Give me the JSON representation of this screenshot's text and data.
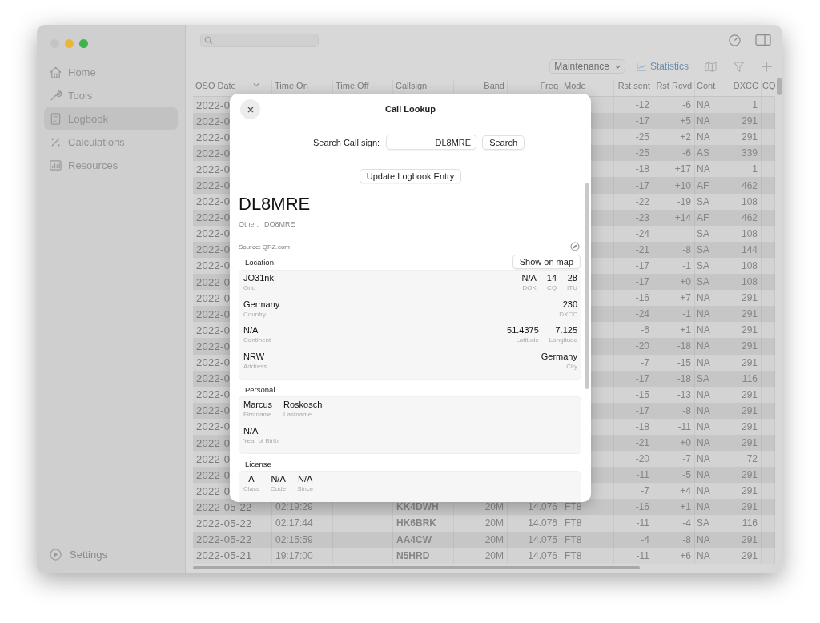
{
  "sidebar": {
    "items": [
      {
        "label": "Home",
        "selected": false
      },
      {
        "label": "Tools",
        "selected": false
      },
      {
        "label": "Logbook",
        "selected": true
      },
      {
        "label": "Calculations",
        "selected": false
      },
      {
        "label": "Resources",
        "selected": false
      }
    ],
    "settings": "Settings"
  },
  "toolbar": {
    "dropdown": "Maintenance",
    "statistics": "Statistics"
  },
  "table": {
    "columns": [
      "QSO Date",
      "Time On",
      "Time Off",
      "Callsign",
      "Band",
      "Freq",
      "Mode",
      "Rst sent",
      "Rst Rcvd",
      "Cont",
      "DXCC",
      "CQ"
    ],
    "rows": [
      {
        "date": "2022-0",
        "rst_sent": "-12",
        "rst_rcvd": "-6",
        "cont": "NA",
        "dxcc": "1"
      },
      {
        "date": "2022-0",
        "rst_sent": "-17",
        "rst_rcvd": "+5",
        "cont": "NA",
        "dxcc": "291"
      },
      {
        "date": "2022-0",
        "rst_sent": "-25",
        "rst_rcvd": "+2",
        "cont": "NA",
        "dxcc": "291"
      },
      {
        "date": "2022-0",
        "rst_sent": "-25",
        "rst_rcvd": "-6",
        "cont": "AS",
        "dxcc": "339"
      },
      {
        "date": "2022-0",
        "rst_sent": "-18",
        "rst_rcvd": "+17",
        "cont": "NA",
        "dxcc": "1"
      },
      {
        "date": "2022-0",
        "rst_sent": "-17",
        "rst_rcvd": "+10",
        "cont": "AF",
        "dxcc": "462"
      },
      {
        "date": "2022-0",
        "rst_sent": "-22",
        "rst_rcvd": "-19",
        "cont": "SA",
        "dxcc": "108"
      },
      {
        "date": "2022-0",
        "rst_sent": "-23",
        "rst_rcvd": "+14",
        "cont": "AF",
        "dxcc": "462"
      },
      {
        "date": "2022-0",
        "rst_sent": "-24",
        "cont": "SA",
        "dxcc": "108"
      },
      {
        "date": "2022-0",
        "rst_sent": "-21",
        "rst_rcvd": "-8",
        "cont": "SA",
        "dxcc": "144"
      },
      {
        "date": "2022-0",
        "rst_sent": "-17",
        "rst_rcvd": "-1",
        "cont": "SA",
        "dxcc": "108"
      },
      {
        "date": "2022-0",
        "rst_sent": "-17",
        "rst_rcvd": "+0",
        "cont": "SA",
        "dxcc": "108"
      },
      {
        "date": "2022-0",
        "rst_sent": "-16",
        "rst_rcvd": "+7",
        "cont": "NA",
        "dxcc": "291"
      },
      {
        "date": "2022-0",
        "rst_sent": "-24",
        "rst_rcvd": "-1",
        "cont": "NA",
        "dxcc": "291"
      },
      {
        "date": "2022-0",
        "rst_sent": "-6",
        "rst_rcvd": "+1",
        "cont": "NA",
        "dxcc": "291"
      },
      {
        "date": "2022-0",
        "rst_sent": "-20",
        "rst_rcvd": "-18",
        "cont": "NA",
        "dxcc": "291"
      },
      {
        "date": "2022-0",
        "rst_sent": "-7",
        "rst_rcvd": "-15",
        "cont": "NA",
        "dxcc": "291"
      },
      {
        "date": "2022-0",
        "rst_sent": "-17",
        "rst_rcvd": "-18",
        "cont": "SA",
        "dxcc": "116"
      },
      {
        "date": "2022-0",
        "rst_sent": "-15",
        "rst_rcvd": "-13",
        "cont": "NA",
        "dxcc": "291"
      },
      {
        "date": "2022-0",
        "rst_sent": "-17",
        "rst_rcvd": "-8",
        "cont": "NA",
        "dxcc": "291"
      },
      {
        "date": "2022-0",
        "rst_sent": "-18",
        "rst_rcvd": "-11",
        "cont": "NA",
        "dxcc": "291"
      },
      {
        "date": "2022-0",
        "rst_sent": "-21",
        "rst_rcvd": "+0",
        "cont": "NA",
        "dxcc": "291"
      },
      {
        "date": "2022-0",
        "rst_sent": "-20",
        "rst_rcvd": "-7",
        "cont": "NA",
        "dxcc": "72"
      },
      {
        "date": "2022-0",
        "rst_sent": "-11",
        "rst_rcvd": "-5",
        "cont": "NA",
        "dxcc": "291"
      },
      {
        "date": "2022-0",
        "rst_sent": "-7",
        "rst_rcvd": "+4",
        "cont": "NA",
        "dxcc": "291"
      },
      {
        "date": "2022-05-22",
        "time_on": "02:19:29",
        "callsign": "KK4DWH",
        "band": "20M",
        "freq": "14.076",
        "mode": "FT8",
        "rst_sent": "-16",
        "rst_rcvd": "+1",
        "cont": "NA",
        "dxcc": "291"
      },
      {
        "date": "2022-05-22",
        "time_on": "02:17:44",
        "callsign": "HK6BRK",
        "band": "20M",
        "freq": "14.076",
        "mode": "FT8",
        "rst_sent": "-11",
        "rst_rcvd": "-4",
        "cont": "SA",
        "dxcc": "116"
      },
      {
        "date": "2022-05-22",
        "time_on": "02:15:59",
        "callsign": "AA4CW",
        "band": "20M",
        "freq": "14.075",
        "mode": "FT8",
        "rst_sent": "-4",
        "rst_rcvd": "-8",
        "cont": "NA",
        "dxcc": "291"
      },
      {
        "date": "2022-05-21",
        "time_on": "19:17:00",
        "callsign": "N5HRD",
        "band": "20M",
        "freq": "14.076",
        "mode": "FT8",
        "rst_sent": "-11",
        "rst_rcvd": "+6",
        "cont": "NA",
        "dxcc": "291"
      }
    ]
  },
  "dialog": {
    "title": "Call Lookup",
    "search_label": "Search Call sign:",
    "search_value": "DL8MRE",
    "search_button": "Search",
    "update_button": "Update Logbook Entry",
    "callsign": "DL8MRE",
    "other_label": "Other:",
    "other_value": "DO8MRE",
    "source": "Source: QRZ.com",
    "sections": [
      {
        "title": "Location",
        "button": "Show on map",
        "rows": [
          {
            "left": [
              {
                "value": "JO31nk",
                "label": "Grid"
              }
            ],
            "right": [
              {
                "value": "N/A",
                "label": "DOK"
              },
              {
                "value": "14",
                "label": "CQ"
              },
              {
                "value": "28",
                "label": "ITU"
              }
            ]
          },
          {
            "left": [
              {
                "value": "Germany",
                "label": "Country"
              }
            ],
            "right": [
              {
                "value": "230",
                "label": "DXCC"
              }
            ]
          },
          {
            "left": [
              {
                "value": "N/A",
                "label": "Continent"
              }
            ],
            "right": [
              {
                "value": "51.4375",
                "label": "Latitude"
              },
              {
                "value": "7.125",
                "label": "Longitude"
              }
            ]
          },
          {
            "left": [
              {
                "value": "NRW",
                "label": "Address"
              }
            ],
            "right": [
              {
                "value": "Germany",
                "label": "City"
              }
            ]
          }
        ]
      },
      {
        "title": "Personal",
        "rows": [
          {
            "left": [
              {
                "value": "Marcus",
                "label": "Firstname"
              },
              {
                "value": "Roskosch",
                "label": "Lastname"
              }
            ]
          },
          {
            "left": [
              {
                "value": "N/A",
                "label": "Year of Birth"
              }
            ]
          }
        ]
      },
      {
        "title": "License",
        "rows": [
          {
            "left": [
              {
                "value": "A",
                "label": "Class"
              },
              {
                "value": "N/A",
                "label": "Code"
              },
              {
                "value": "N/A",
                "label": "Since"
              }
            ]
          }
        ]
      }
    ]
  }
}
